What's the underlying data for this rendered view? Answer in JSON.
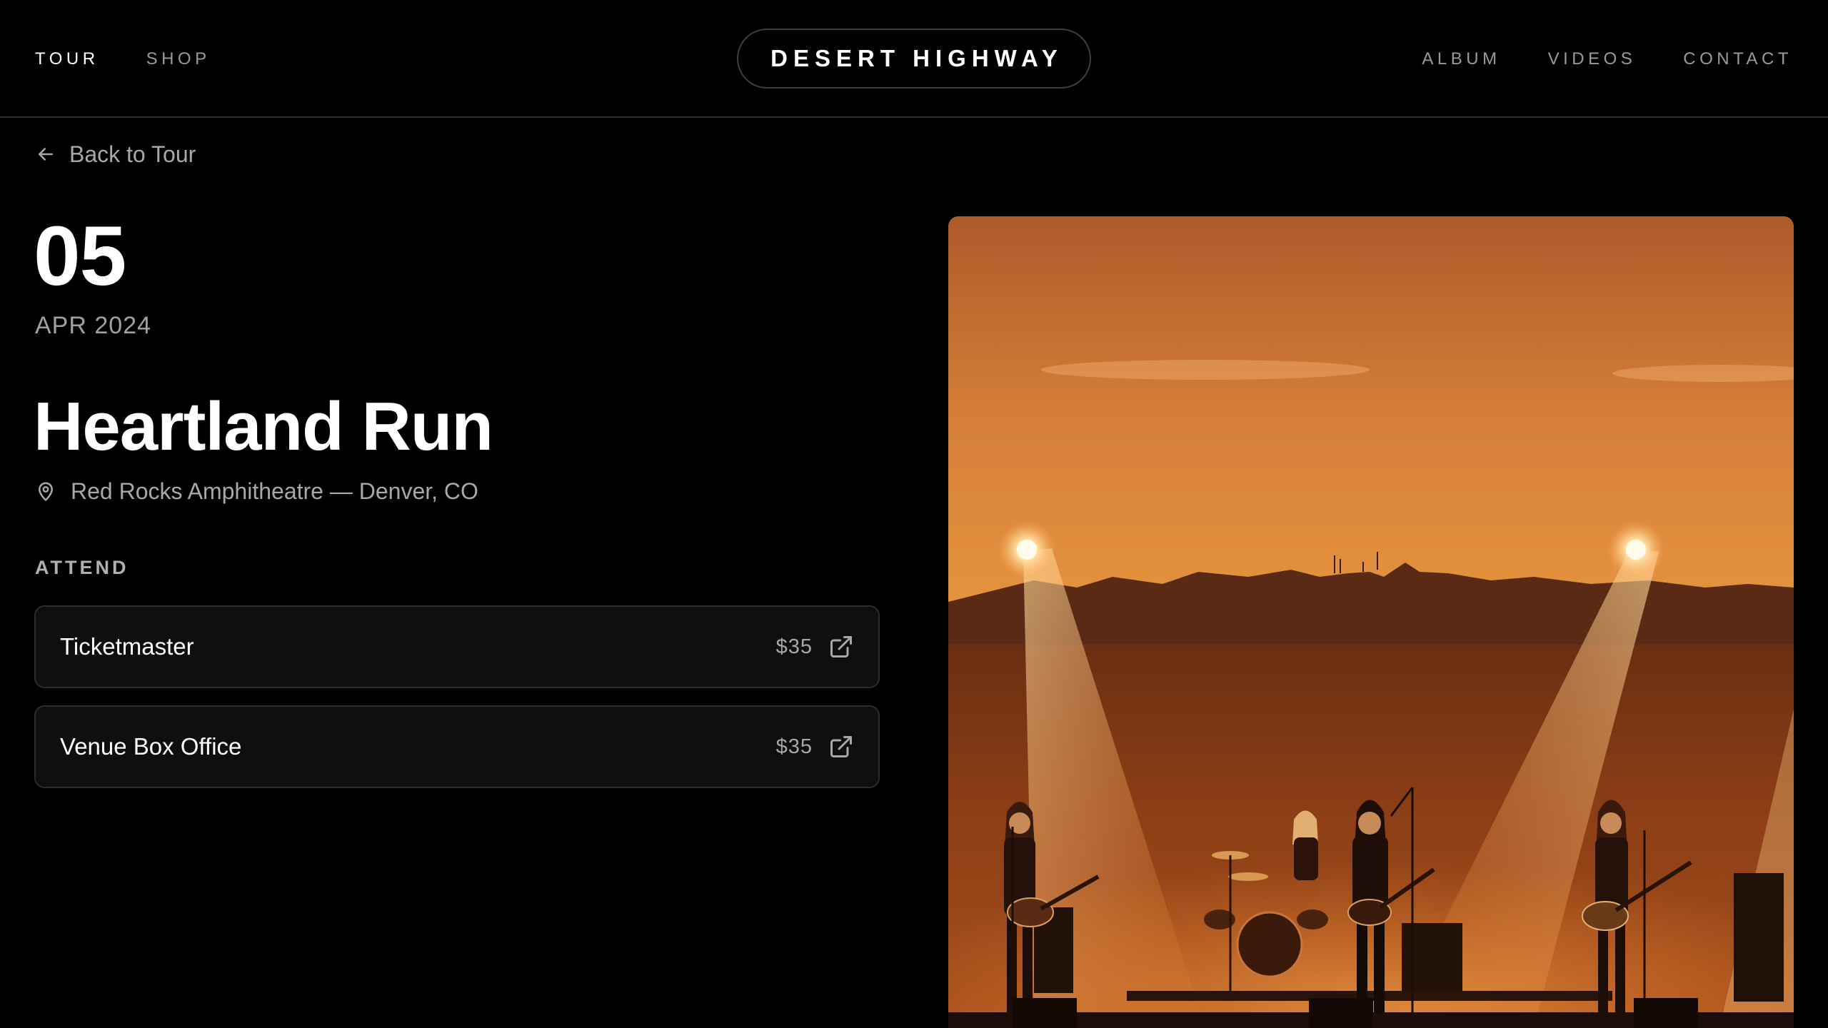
{
  "nav": {
    "left": [
      "TOUR",
      "SHOP"
    ],
    "right": [
      "ALBUM",
      "VIDEOS",
      "CONTACT"
    ],
    "brand": "DESERT HIGHWAY"
  },
  "back_link": "Back to Tour",
  "event": {
    "day": "05",
    "month_year": "APR 2024",
    "title": "Heartland Run",
    "venue": "Red Rocks Amphitheatre — Denver, CO"
  },
  "attend": {
    "label": "ATTEND",
    "options": [
      {
        "name": "Ticketmaster",
        "price": "$35"
      },
      {
        "name": "Venue Box Office",
        "price": "$35"
      }
    ]
  },
  "icons": {
    "back": "arrow-left-icon",
    "venue": "map-pin-icon",
    "external": "external-link-icon"
  },
  "colors": {
    "background": "#000000",
    "hero_sky_top": "#b45f2b",
    "hero_sky_mid": "#e08a3c"
  }
}
